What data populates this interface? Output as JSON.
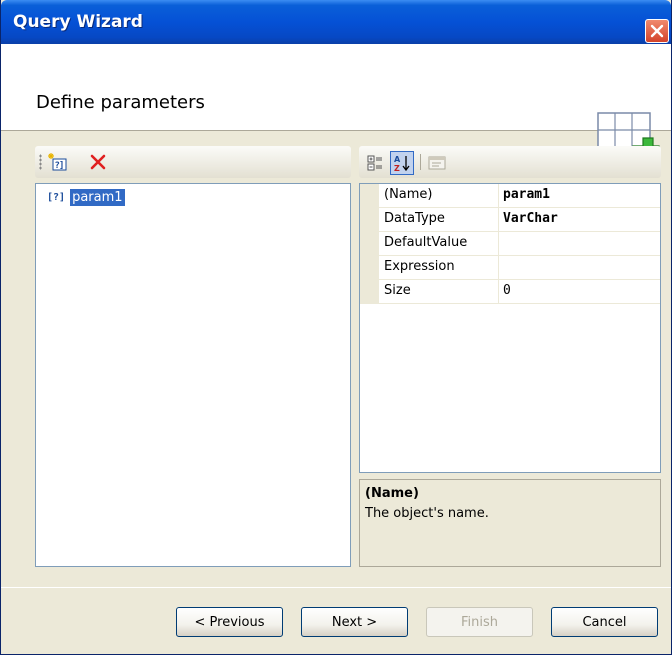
{
  "window": {
    "title": "Query Wizard"
  },
  "header": {
    "heading": "Define parameters"
  },
  "left_toolbar": {
    "add_icon": "add-parameter-icon",
    "delete_icon": "delete-icon"
  },
  "parameters": [
    {
      "icon": "[?]",
      "label": "param1",
      "selected": true
    }
  ],
  "right_toolbar": {
    "categorized_icon": "categorized-icon",
    "alphabetical_icon": "sort-alphabetical-icon",
    "property_pages_icon": "property-pages-icon"
  },
  "properties": [
    {
      "name": "(Name)",
      "value": "param1",
      "bold": true
    },
    {
      "name": "DataType",
      "value": "VarChar",
      "bold": true
    },
    {
      "name": "DefaultValue",
      "value": "",
      "bold": false
    },
    {
      "name": "Expression",
      "value": "",
      "bold": false
    },
    {
      "name": "Size",
      "value": "0",
      "bold": false
    }
  ],
  "description": {
    "title": "(Name)",
    "text": "The object's name."
  },
  "buttons": {
    "previous": "< Previous",
    "next": "Next >",
    "finish": "Finish",
    "cancel": "Cancel"
  },
  "colors": {
    "titlebar": "#0551d6",
    "selection": "#316ac5",
    "close": "#d4432a",
    "delete": "#e02020",
    "add_cross": "#3cb83c"
  }
}
